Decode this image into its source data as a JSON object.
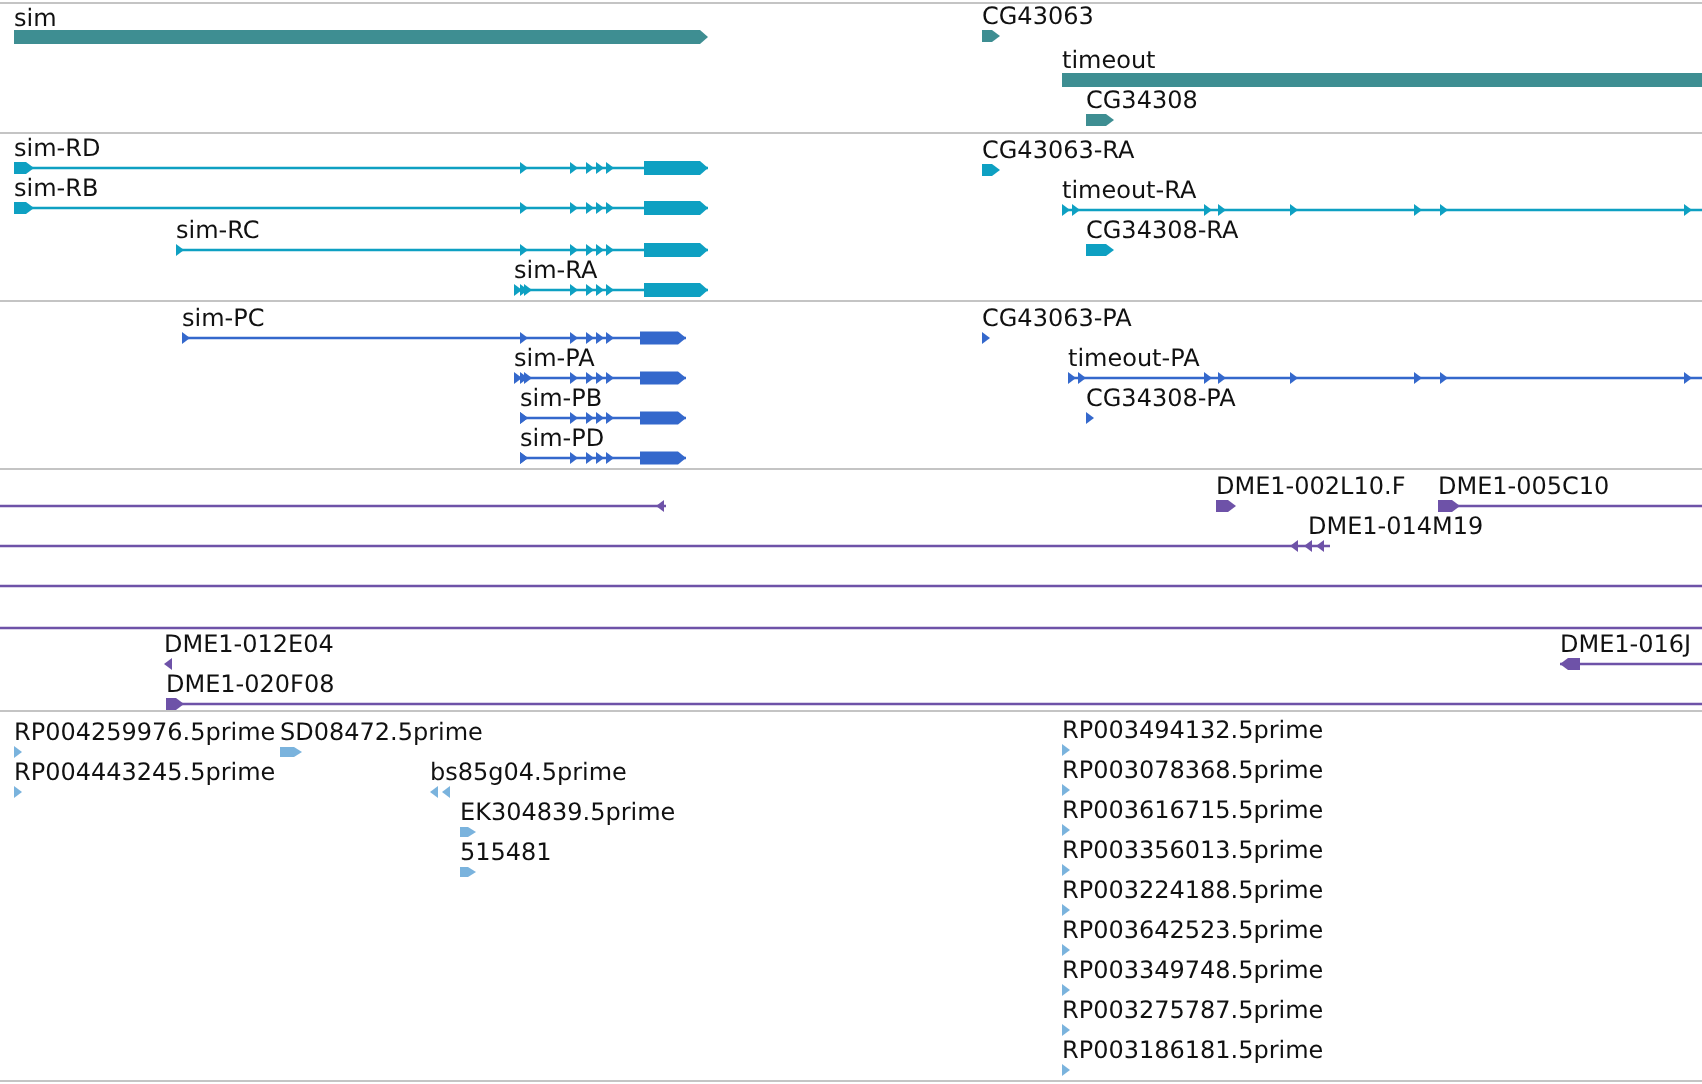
{
  "tracks": [
    {
      "kind": "gene",
      "color": "#3e8e92",
      "features": [
        {
          "label": "sim",
          "reverse": false
        },
        {
          "label": "CG43063",
          "reverse": false
        },
        {
          "label": "timeout",
          "reverse": false
        },
        {
          "label": "CG34308",
          "reverse": false
        }
      ]
    },
    {
      "kind": "transcript",
      "color": "#0ea0c2",
      "features": [
        {
          "label": "sim-RD",
          "reverse": false
        },
        {
          "label": "sim-RB",
          "reverse": false
        },
        {
          "label": "sim-RC",
          "reverse": false
        },
        {
          "label": "sim-RA",
          "reverse": false
        },
        {
          "label": "CG43063-RA",
          "reverse": false
        },
        {
          "label": "timeout-RA",
          "reverse": false
        },
        {
          "label": "CG34308-RA",
          "reverse": false
        }
      ]
    },
    {
      "kind": "protein",
      "color": "#3468cc",
      "features": [
        {
          "label": "sim-PC",
          "reverse": false
        },
        {
          "label": "sim-PA",
          "reverse": false
        },
        {
          "label": "sim-PB",
          "reverse": false
        },
        {
          "label": "sim-PD",
          "reverse": false
        },
        {
          "label": "CG43063-PA",
          "reverse": false
        },
        {
          "label": "timeout-PA",
          "reverse": false
        },
        {
          "label": "CG34308-PA",
          "reverse": false
        }
      ]
    },
    {
      "kind": "clone",
      "color": "#6e52a8",
      "features": [
        {
          "kind": "end",
          "reverse": true
        },
        {
          "kind": "end",
          "label": "DME1-002L10.F",
          "reverse": false
        },
        {
          "kind": "end",
          "label": "DME1-005C10",
          "reverse": false
        },
        {
          "kind": "end",
          "label": "DME1-014M19",
          "reverse": true
        },
        {
          "kind": "span"
        },
        {
          "kind": "span"
        },
        {
          "kind": "end",
          "label": "DME1-012E04",
          "reverse": true
        },
        {
          "kind": "end",
          "label": "DME1-020F08",
          "reverse": false
        },
        {
          "kind": "end",
          "label": "DME1-016J",
          "reverse": true
        }
      ]
    },
    {
      "kind": "read",
      "color": "#7ab3dd",
      "features": [
        {
          "label": "RP004259976.5prime",
          "reverse": false
        },
        {
          "label": "SD08472.5prime",
          "reverse": false
        },
        {
          "label": "RP004443245.5prime",
          "reverse": false
        },
        {
          "label": "bs85g04.5prime",
          "reverse": true
        },
        {
          "label": "EK304839.5prime",
          "reverse": false
        },
        {
          "label": "515481",
          "reverse": false
        },
        {
          "label": "RP003494132.5prime",
          "reverse": false
        },
        {
          "label": "RP003078368.5prime",
          "reverse": false
        },
        {
          "label": "RP003616715.5prime",
          "reverse": false
        },
        {
          "label": "RP003356013.5prime",
          "reverse": false
        },
        {
          "label": "RP003224188.5prime",
          "reverse": false
        },
        {
          "label": "RP003642523.5prime",
          "reverse": false
        },
        {
          "label": "RP003349748.5prime",
          "reverse": false
        },
        {
          "label": "RP003275787.5prime",
          "reverse": false
        },
        {
          "label": "RP003186181.5prime",
          "reverse": false
        }
      ]
    }
  ]
}
